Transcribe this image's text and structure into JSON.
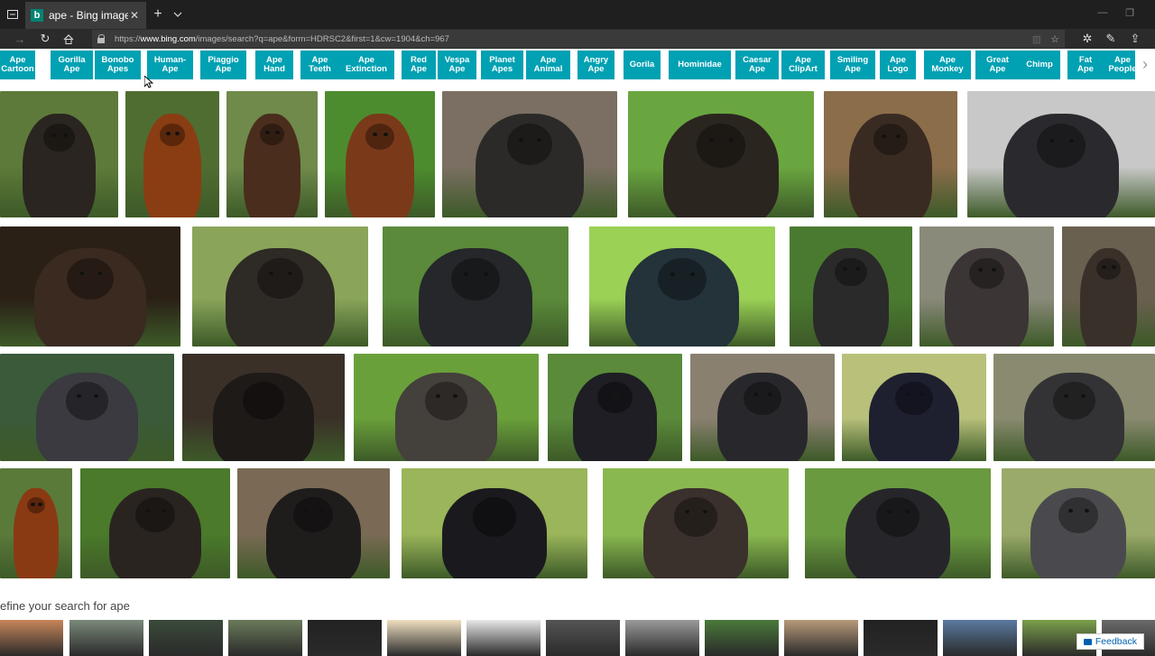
{
  "tab": {
    "title": "ape - Bing images",
    "favicon_letter": "b"
  },
  "address": {
    "prefix": "https://",
    "host": "www.bing.com",
    "path": "/images/search?q=ape&form=HDRSC2&first=1&cw=1904&ch=967"
  },
  "related": [
    "Ape Cartoon",
    "Gorilla Ape",
    "Bonobo Apes",
    "Human-Ape",
    "Piaggio Ape",
    "Ape Hand",
    "Ape Teeth",
    "Ape Extinction",
    "Red Ape",
    "Vespa Ape",
    "Planet Apes",
    "Ape Animal",
    "Angry Ape",
    "Gorila",
    "Hominidae",
    "Caesar Ape",
    "Ape ClipArt",
    "Smiling Ape",
    "Ape Logo",
    "Ape Monkey",
    "Great Ape",
    "Chimp",
    "Fat Ape",
    "Ape People"
  ],
  "refine_text": "efine your search for ape",
  "feedback_label": "Feedback",
  "colors": {
    "chip_bg": "#00a1b3",
    "tabbar_bg": "#1f1f1f",
    "urlbar_bg": "#3a3a3a"
  },
  "icons": [
    "tab-actions-icon",
    "new-tab-icon",
    "tab-list-icon",
    "back-icon",
    "forward-icon",
    "refresh-icon",
    "home-icon",
    "lock-icon",
    "reading-view-icon",
    "favorite-star-icon",
    "favorites-hub-icon",
    "pen-icon",
    "share-icon",
    "chevron-right-icon",
    "feedback-icon"
  ]
}
